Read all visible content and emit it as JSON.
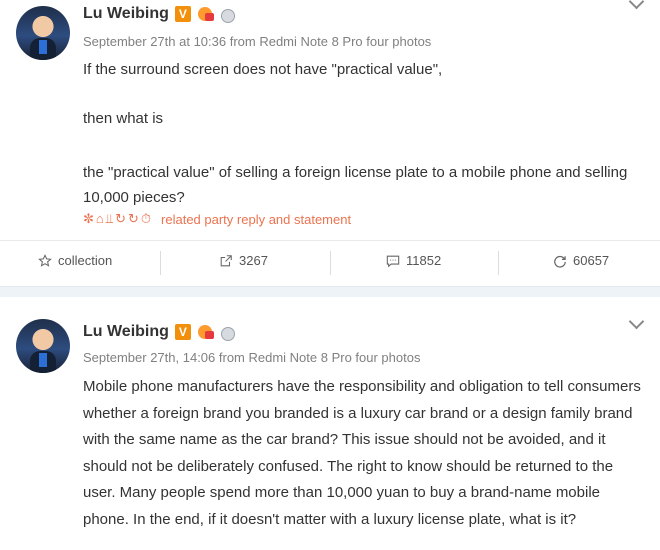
{
  "posts": [
    {
      "author": "Lu Weibing",
      "meta": "September 27th at 10:36 from Redmi Note 8 Pro four photos",
      "text_lines": [
        "If the surround screen does not have \"practical value\",",
        "then what is",
        "the \"practical value\" of selling a foreign license plate to a mobile phone and selling 10,000 pieces?"
      ],
      "related_label": "related party reply and statement",
      "actions": {
        "collection": "collection",
        "share_count": "3267",
        "comment_count": "11852",
        "like_count": "60657"
      }
    },
    {
      "author": "Lu Weibing",
      "meta": "September 27th, 14:06 from Redmi Note 8 Pro four photos",
      "text": "Mobile phone manufacturers have the responsibility and obligation to tell consumers whether a foreign brand you branded is a luxury car brand or a design family brand with the same name as the car brand? This issue should not be avoided, and it should not be deliberately confused. The right to know should be returned to the user. Many people spend more than 10,000 yuan to buy a brand-name mobile phone. In the end, if it doesn't matter with a luxury license plate, what is it?"
    }
  ],
  "badges": {
    "verified": "V"
  },
  "colors": {
    "accent": "#eb7350",
    "verified_badge": "#f28f0b",
    "divider": "#eef3f7"
  },
  "icons": [
    "star-icon",
    "share-icon",
    "comment-icon",
    "like-icon",
    "chevron-down-icon"
  ]
}
